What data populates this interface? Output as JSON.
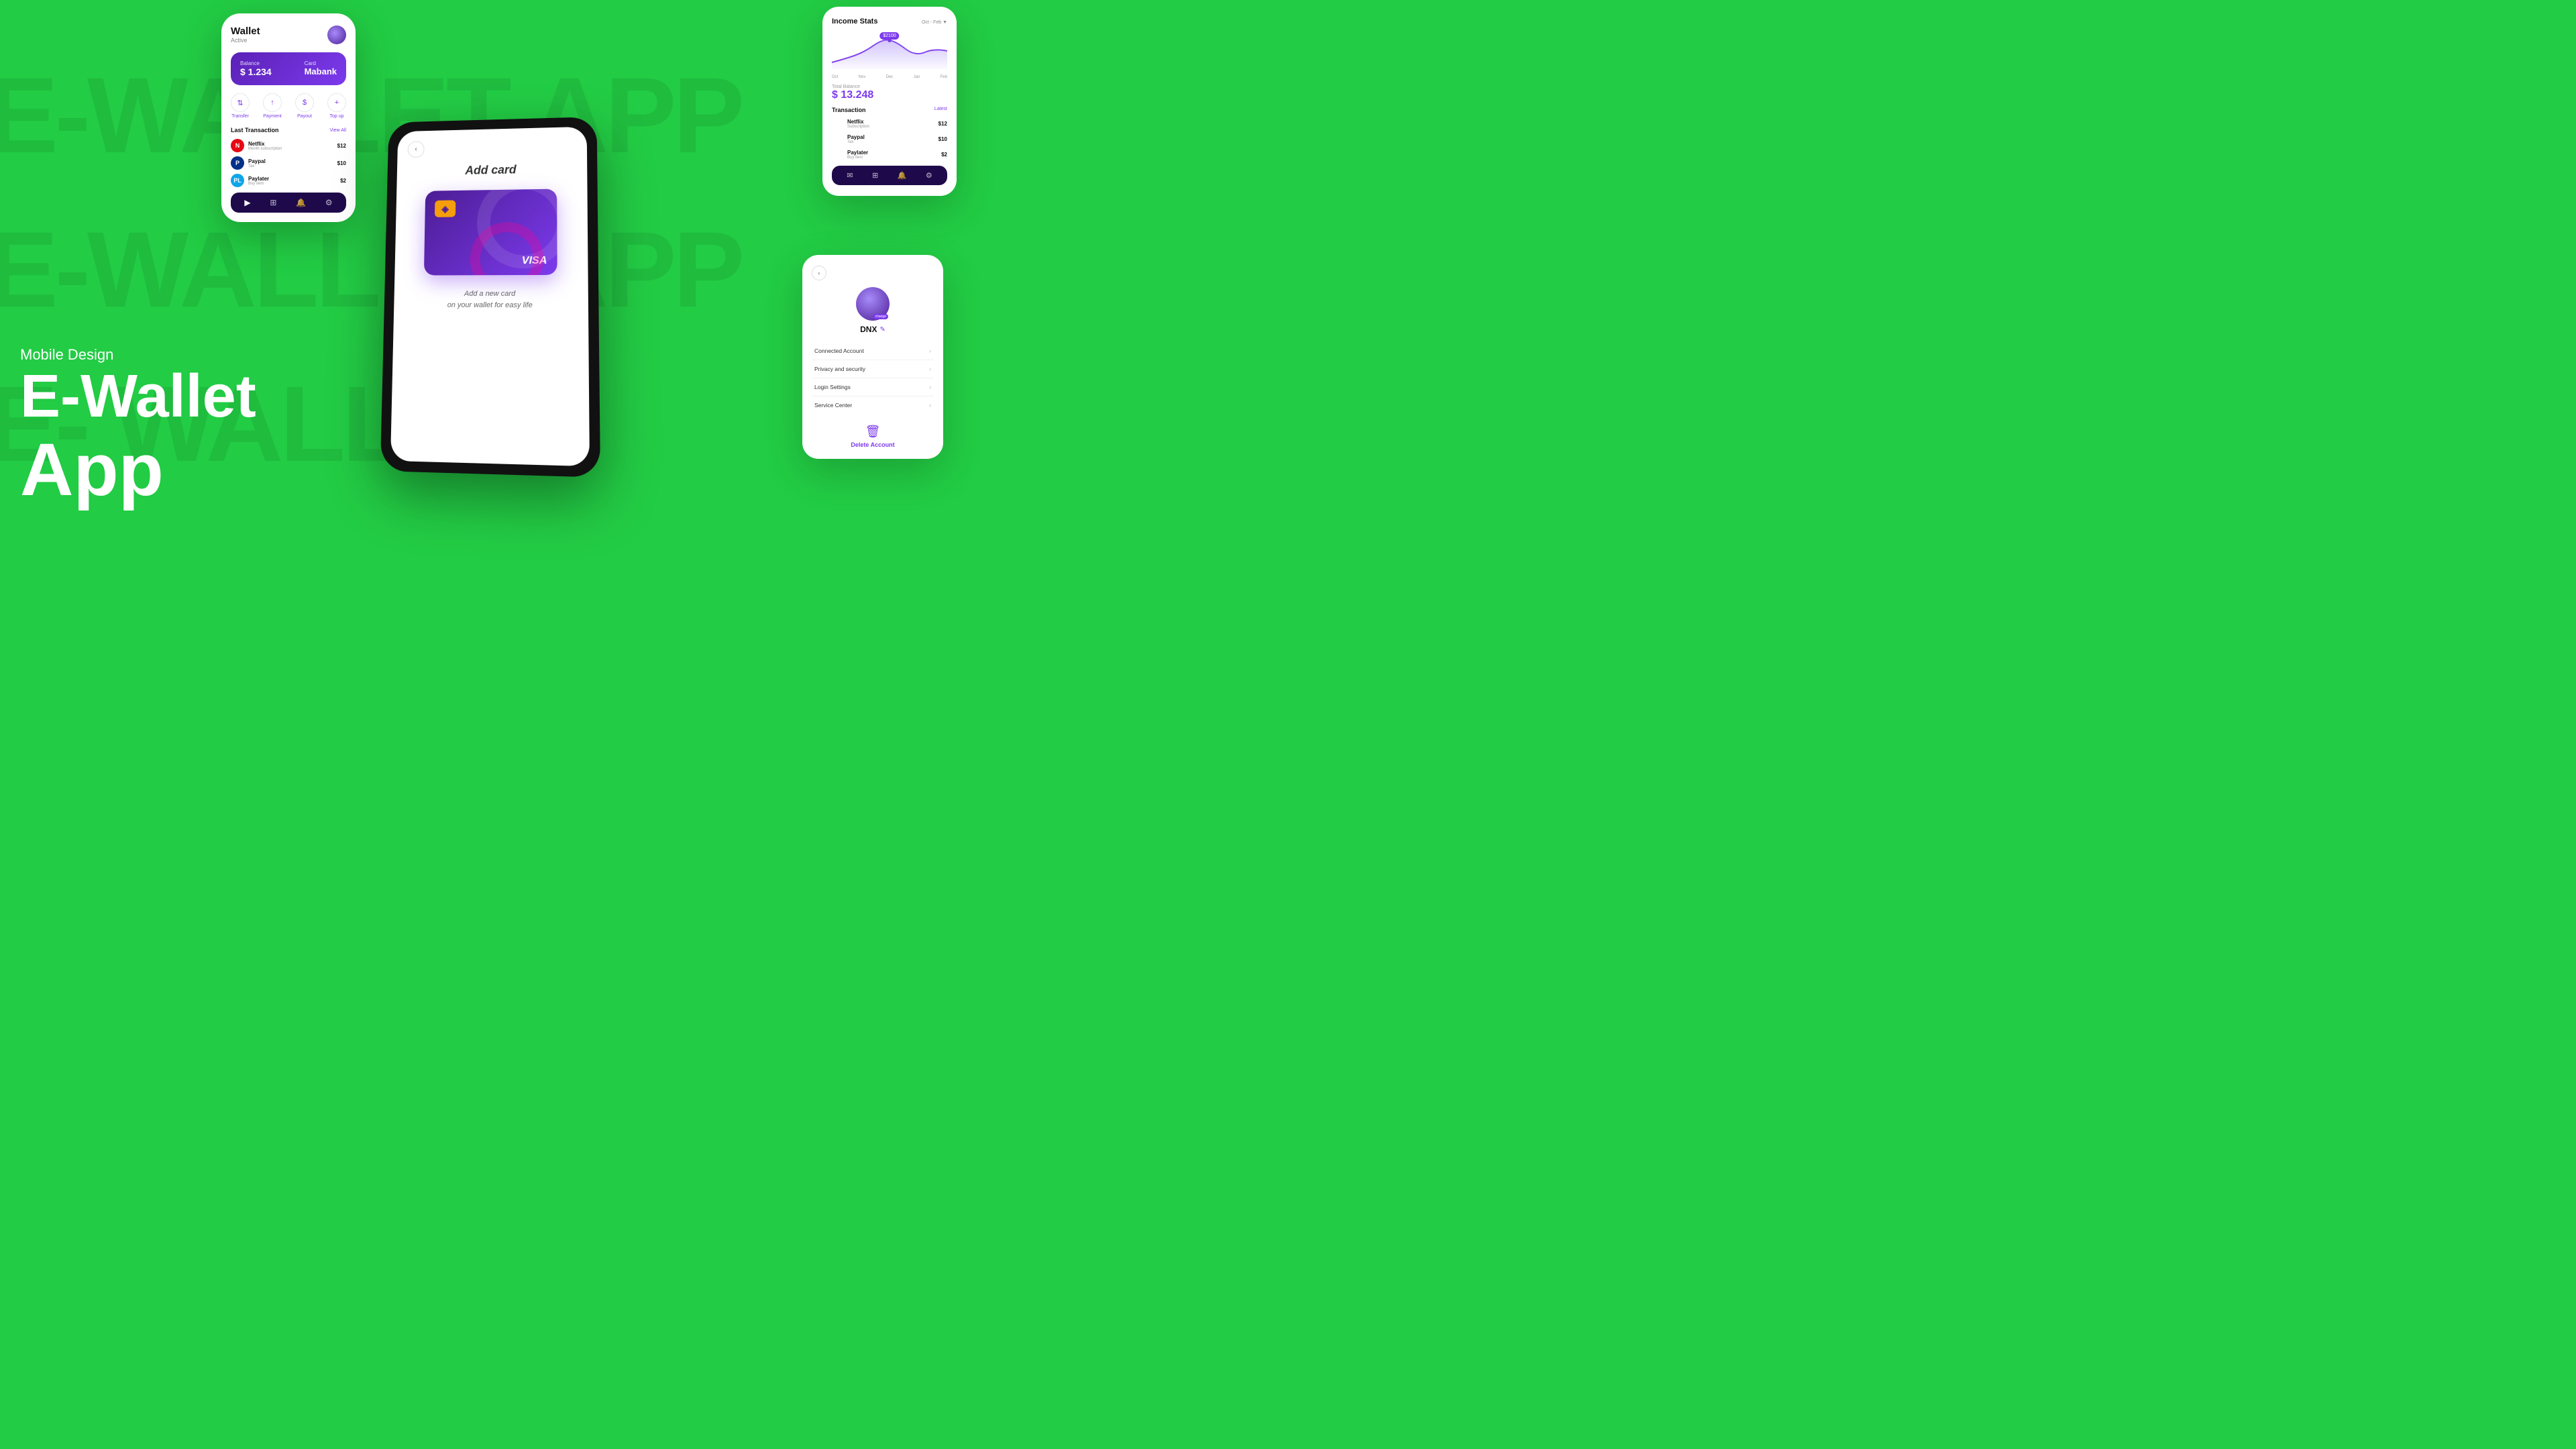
{
  "background": {
    "color": "#22cc44"
  },
  "watermarks": [
    "E-WALLET APP",
    "E-WALLET APP",
    "E- WALLET"
  ],
  "left_text": {
    "subtitle": "Mobile Design",
    "title": "E-Wallet",
    "app_label": "App"
  },
  "wallet_screen": {
    "title": "Wallet",
    "status": "Active",
    "balance_label": "Balance",
    "balance_amount": "$ 1.234",
    "card_label": "Card",
    "card_name": "Mabank",
    "actions": [
      "Transfer",
      "Payment",
      "Payout",
      "Top up"
    ],
    "last_transaction_label": "Last Transaction",
    "view_all": "View All",
    "transactions": [
      {
        "name": "Netflix",
        "sub": "Month subscription",
        "amount": "$12",
        "type": "netflix"
      },
      {
        "name": "Paypal",
        "sub": "Tax",
        "amount": "$10",
        "type": "paypal"
      },
      {
        "name": "Paylater",
        "sub": "Buy item",
        "amount": "$2",
        "type": "paylater"
      }
    ]
  },
  "add_card_screen": {
    "title": "Add card",
    "card_brand": "VISA",
    "description_line1": "Add a new card",
    "description_line2": "on your wallet for easy life"
  },
  "income_stats_screen": {
    "title": "Income Stats",
    "date_range": "Oct - Feb",
    "chart_tooltip": "$2100",
    "chart_labels": [
      "Oct",
      "Nov",
      "Dec",
      "Jan",
      "Feb"
    ],
    "total_balance_label": "Total Balance",
    "total_balance": "$ 13.248",
    "transaction_label": "Transaction",
    "latest_label": "Latest",
    "transactions": [
      {
        "name": "Netflix",
        "sub": "Subscription",
        "amount": "$12",
        "type": "netflix"
      },
      {
        "name": "Paypal",
        "sub": "Tax",
        "amount": "$10",
        "type": "paypal"
      },
      {
        "name": "Paylater",
        "sub": "Buy item",
        "amount": "$2",
        "type": "paylater"
      }
    ]
  },
  "profile_screen": {
    "user_name": "DNX",
    "change_label": "change",
    "menu_items": [
      "Connected Account",
      "Privacy and security",
      "Login Settings",
      "Service Center"
    ],
    "delete_label": "Delete Account"
  }
}
